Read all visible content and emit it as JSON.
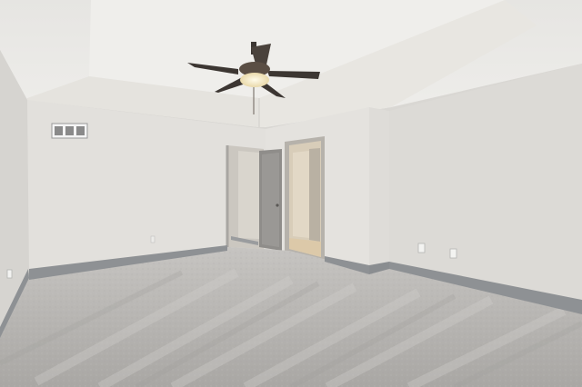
{
  "scene": {
    "subject": "empty-bedroom-interior",
    "colors": {
      "ceiling": "#ecebe8",
      "tray_band": "#e3e1dc",
      "wall_back": "#e2e0dc",
      "wall_right": "#dcdad6",
      "wall_left": "#d6d4d0",
      "baseboard": "#8e9194",
      "carpet": "#bdbbb8",
      "door": "#8f8d8a",
      "fan_blade": "#3c3632",
      "fan_light": "#f3e8c8",
      "vent": "#c9c9c9"
    }
  }
}
